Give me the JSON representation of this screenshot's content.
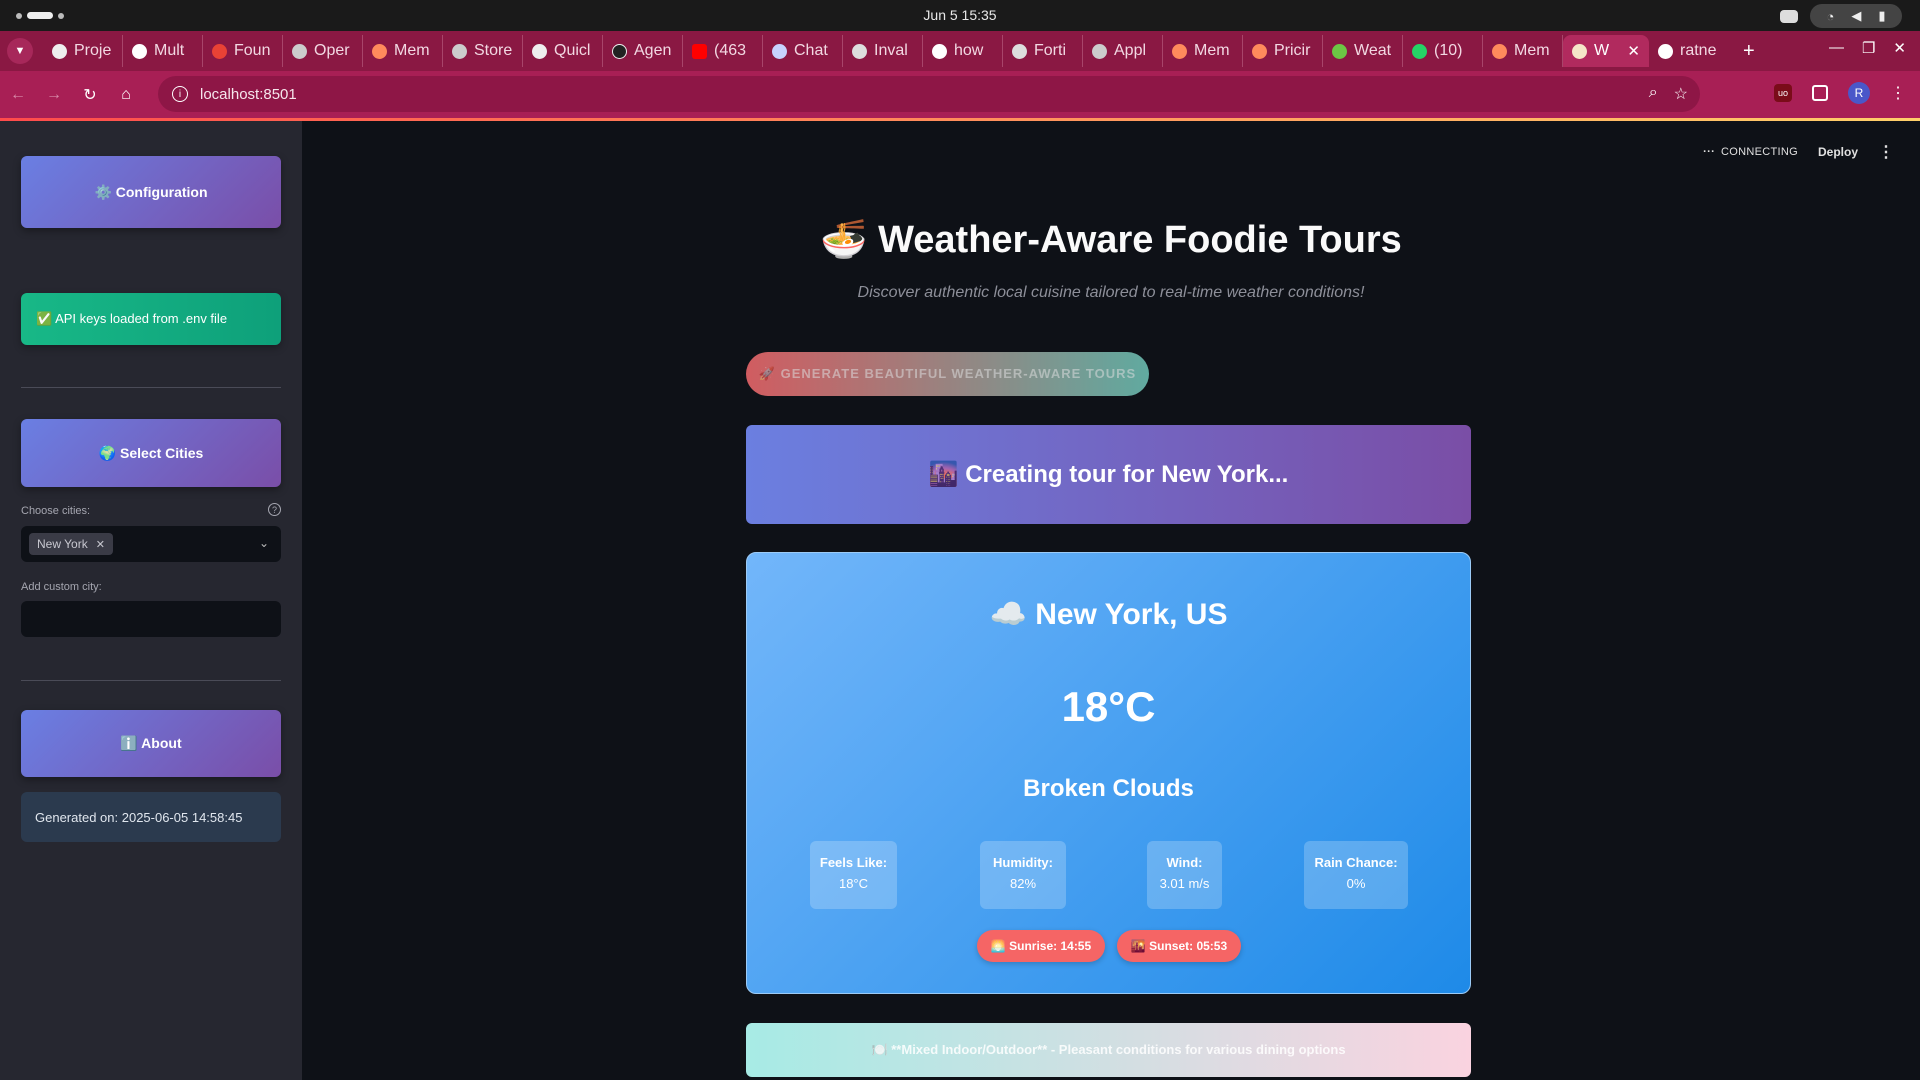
{
  "os": {
    "clock": "Jun 5  15:35"
  },
  "browser": {
    "tabs": [
      "Proje",
      "Mult",
      "Foun",
      "Oper",
      "Mem",
      "Store",
      "Quicl",
      "Agen",
      "(463",
      "Chat",
      "Inval",
      "how",
      "Forti",
      "Appl",
      "Mem",
      "Pricir",
      "Weat",
      "(10)",
      "Mem"
    ],
    "active_tab": "W",
    "last_tab": "ratne",
    "url": "localhost:8501"
  },
  "sidebar": {
    "config_label": "⚙️ Configuration",
    "api_status": "✅ API keys loaded from .env file",
    "cities_label": "🌍 Select Cities",
    "choose_label": "Choose cities:",
    "selected_city": "New York",
    "custom_label": "Add custom city:",
    "about_label": "ℹ️ About",
    "generated": "Generated on: 2025-06-05 14:58:45"
  },
  "toolbar": {
    "status": "CONNECTING",
    "deploy": "Deploy"
  },
  "main": {
    "title": "🍜 Weather-Aware Foodie Tours",
    "subtitle": "Discover authentic local cuisine tailored to real-time weather conditions!",
    "generate_button": "🚀 GENERATE BEAUTIFUL WEATHER-AWARE TOURS",
    "creating": "🌆 Creating tour for New York...",
    "weather": {
      "city": "☁️ New York, US",
      "temp": "18°C",
      "description": "Broken Clouds",
      "stats": [
        {
          "label": "Feels Like:",
          "value": "18°C"
        },
        {
          "label": "Humidity:",
          "value": "82%"
        },
        {
          "label": "Wind:",
          "value": "3.01 m/s"
        },
        {
          "label": "Rain Chance:",
          "value": "0%"
        }
      ],
      "sunrise": "🌅 Sunrise: 14:55",
      "sunset": "🌇 Sunset: 05:53"
    },
    "dining_note": "🍽️ **Mixed Indoor/Outdoor** - Pleasant conditions for various dining options"
  }
}
